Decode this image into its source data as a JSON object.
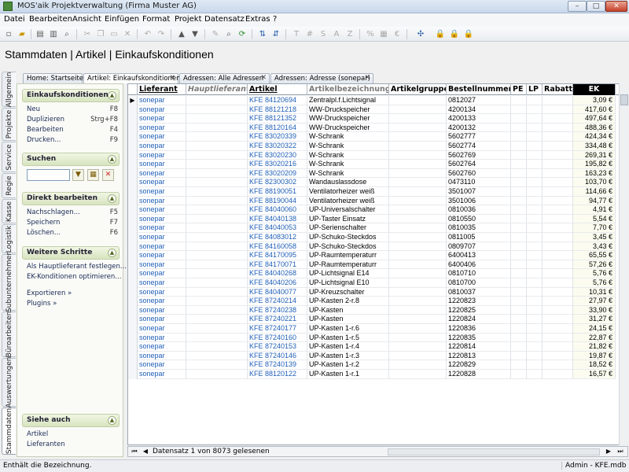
{
  "window": {
    "title": "MOS'aik Projektverwaltung (Firma Muster AG)"
  },
  "menu": [
    "Datei",
    "Bearbeiten",
    "Ansicht",
    "Einfügen",
    "Format",
    "Projekt",
    "Datensatz",
    "Extras",
    "?"
  ],
  "page_title": "Stammdaten | Artikel | Einkaufskonditionen",
  "vertical_tabs": [
    "Allgemein",
    "Projekte",
    "Service",
    "Regie",
    "Kasse",
    "Logistik",
    "Subunternehmer",
    "Büroarbeiten",
    "Auswertungen",
    "Stammdaten"
  ],
  "doc_tabs": [
    {
      "label": "Home: Startseite"
    },
    {
      "label": "Artikel: Einkaufskonditionen"
    },
    {
      "label": "Adressen: Alle Adressen"
    },
    {
      "label": "Adressen: Adresse (sonepar)"
    }
  ],
  "left_panel": {
    "section1": {
      "title": "Einkaufskonditionen",
      "items": [
        {
          "label": "Neu",
          "shortcut": "F8"
        },
        {
          "label": "Duplizieren",
          "shortcut": "Strg+F8"
        },
        {
          "label": "Bearbeiten",
          "shortcut": "F4"
        },
        {
          "label": "Drucken...",
          "shortcut": "F9"
        }
      ]
    },
    "section2": {
      "title": "Suchen",
      "search_value": ""
    },
    "section3": {
      "title": "Direkt bearbeiten",
      "items": [
        {
          "label": "Nachschlagen...",
          "shortcut": "F5"
        },
        {
          "label": "Speichern",
          "shortcut": "F7"
        },
        {
          "label": "Löschen...",
          "shortcut": "F6"
        }
      ]
    },
    "section4": {
      "title": "Weitere Schritte",
      "items": [
        {
          "label": "Als Hauptlieferant festlegen..."
        },
        {
          "label": "EK-Konditionen optimieren..."
        },
        {
          "label": "Exportieren »"
        },
        {
          "label": "Plugins »"
        }
      ]
    },
    "section5": {
      "title": "Siehe auch",
      "items": [
        {
          "label": "Artikel"
        },
        {
          "label": "Lieferanten"
        }
      ]
    }
  },
  "grid": {
    "columns": [
      "Lieferant",
      "Hauptlieferant",
      "Artikel",
      "Artikelbezeichnung",
      "Artikelgruppe",
      "Bestellnummer",
      "PE",
      "LP",
      "Rabatt",
      "EK"
    ],
    "rows": [
      [
        "sonepar",
        "KFE 84120694",
        "Zentralpl.f.Lichtsignal",
        "0812027",
        "3,09 €"
      ],
      [
        "sonepar",
        "KFE 88121218",
        "WW-Druckspeicher",
        "4200134",
        "417,60 €"
      ],
      [
        "sonepar",
        "KFE 88121352",
        "WW-Druckspeicher",
        "4200133",
        "497,64 €"
      ],
      [
        "sonepar",
        "KFE 88120164",
        "WW-Druckspeicher",
        "4200132",
        "488,36 €"
      ],
      [
        "sonepar",
        "KFE 83020339",
        "W-Schrank",
        "5602777",
        "424,34 €"
      ],
      [
        "sonepar",
        "KFE 83020322",
        "W-Schrank",
        "5602774",
        "334,48 €"
      ],
      [
        "sonepar",
        "KFE 83020230",
        "W-Schrank",
        "5602769",
        "269,31 €"
      ],
      [
        "sonepar",
        "KFE 83020216",
        "W-Schrank",
        "5602764",
        "195,82 €"
      ],
      [
        "sonepar",
        "KFE 83020209",
        "W-Schrank",
        "5602760",
        "163,23 €"
      ],
      [
        "sonepar",
        "KFE 82300302",
        "Wandauslassdose",
        "0473110",
        "103,70 €"
      ],
      [
        "sonepar",
        "KFE 88190051",
        "Ventilatorheizer weiß",
        "3501007",
        "114,66 €"
      ],
      [
        "sonepar",
        "KFE 88190044",
        "Ventilatorheizer weiß",
        "3501006",
        "94,77 €"
      ],
      [
        "sonepar",
        "KFE 84040060",
        "UP-Universalschalter",
        "0810036",
        "4,91 €"
      ],
      [
        "sonepar",
        "KFE 84040138",
        "UP-Taster Einsatz",
        "0810550",
        "5,54 €"
      ],
      [
        "sonepar",
        "KFE 84040053",
        "UP-Serienschalter",
        "0810035",
        "7,70 €"
      ],
      [
        "sonepar",
        "KFE 84083012",
        "UP-Schuko-Steckdos",
        "0811005",
        "3,45 €"
      ],
      [
        "sonepar",
        "KFE 84160058",
        "UP-Schuko-Steckdos",
        "0809707",
        "3,43 €"
      ],
      [
        "sonepar",
        "KFE 84170095",
        "UP-Raumtemperaturr",
        "6400413",
        "65,55 €"
      ],
      [
        "sonepar",
        "KFE 84170071",
        "UP-Raumtemperaturr",
        "6400406",
        "57,26 €"
      ],
      [
        "sonepar",
        "KFE 84040268",
        "UP-Lichtsignal E14",
        "0810710",
        "5,76 €"
      ],
      [
        "sonepar",
        "KFE 84040206",
        "UP-Lichtsignal E10",
        "0810700",
        "5,76 €"
      ],
      [
        "sonepar",
        "KFE 84040077",
        "UP-Kreuzschalter",
        "0810037",
        "10,31 €"
      ],
      [
        "sonepar",
        "KFE 87240214",
        "UP-Kasten 2-r.8",
        "1220823",
        "27,97 €"
      ],
      [
        "sonepar",
        "KFE 87240238",
        "UP-Kasten",
        "1220825",
        "33,90 €"
      ],
      [
        "sonepar",
        "KFE 87240221",
        "UP-Kasten",
        "1220824",
        "31,27 €"
      ],
      [
        "sonepar",
        "KFE 87240177",
        "UP-Kasten 1-r.6",
        "1220836",
        "24,15 €"
      ],
      [
        "sonepar",
        "KFE 87240160",
        "UP-Kasten 1-r.5",
        "1220835",
        "22,87 €"
      ],
      [
        "sonepar",
        "KFE 87240153",
        "UP-Kasten 1-r.4",
        "1220814",
        "21,82 €"
      ],
      [
        "sonepar",
        "KFE 87240146",
        "UP-Kasten 1-r.3",
        "1220813",
        "19,87 €"
      ],
      [
        "sonepar",
        "KFE 87240139",
        "UP-Kasten 1-r.2",
        "1220829",
        "18,52 €"
      ],
      [
        "sonepar",
        "KFE 88120122",
        "UP-Kasten 1-r.1",
        "1220828",
        "16,57 €"
      ]
    ]
  },
  "navbar": {
    "text": "Datensatz 1 von 8073 gelesenen"
  },
  "status": {
    "left": "Enthält die Bezeichnung.",
    "right": "Admin - KFE.mdb"
  }
}
